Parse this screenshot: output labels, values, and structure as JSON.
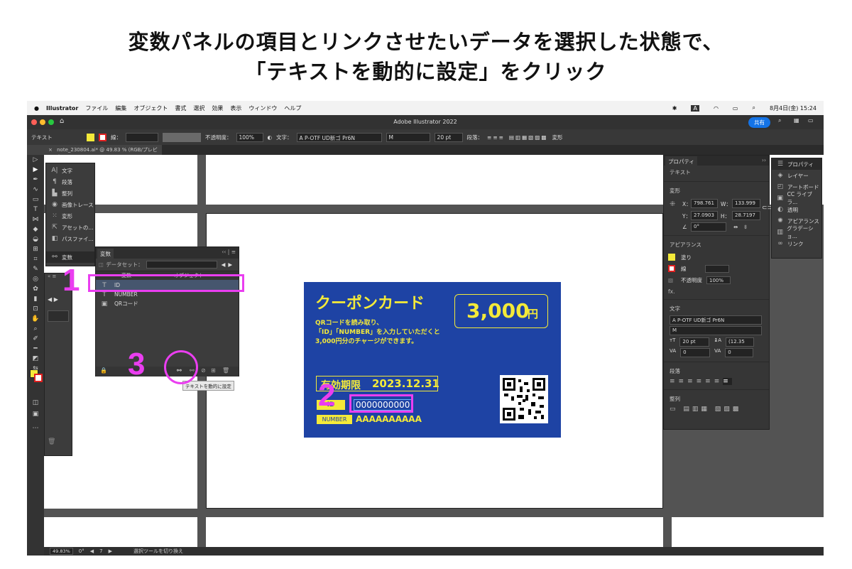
{
  "heading": {
    "line1": "変数パネルの項目とリンクさせたいデータを選択した状態で、",
    "line2": "「テキストを動的に設定」をクリック"
  },
  "menubar": {
    "app": "Illustrator",
    "items": [
      "ファイル",
      "編集",
      "オブジェクト",
      "書式",
      "選択",
      "効果",
      "表示",
      "ウィンドウ",
      "ヘルプ"
    ],
    "ime": "A",
    "date": "8月4日(金)  15:24"
  },
  "window": {
    "title": "Adobe Illustrator 2022",
    "share": "共有"
  },
  "control": {
    "mode": "テキスト",
    "stroke_label": "線：",
    "opacity_label": "不透明度：",
    "opacity": "100%",
    "font_label": "文字：",
    "font": "A P-OTF UD新ゴ Pr6N",
    "weight": "M",
    "size": "20 pt",
    "para_label": "段落：",
    "transform": "変形"
  },
  "doc_tab": {
    "close": "×",
    "label": "note_230804.ai* @ 49.83 % (RGB/プレビュー)"
  },
  "collapsed_panels": [
    "文字",
    "段落",
    "整列",
    "画像トレース",
    "変形",
    "アセットの...",
    "パスファイ...",
    "変数"
  ],
  "variables_panel": {
    "tab": "変数",
    "dataset_label": "データセット：",
    "col_var": "変数",
    "col_obj": "オブジェクト",
    "rows": [
      {
        "type": "T",
        "name": "ID"
      },
      {
        "type": "T",
        "name": "NUMBER"
      },
      {
        "type": "▣",
        "name": "QRコード"
      }
    ],
    "tooltip": "テキストを動的に設定"
  },
  "coupon": {
    "title": "クーポンカード",
    "amount": "3,000",
    "yen": "円",
    "desc1": "QRコードを読み取り、",
    "desc2": "「ID」「NUMBER」を入力していただくと",
    "desc3": "3,000円分のチャージができます。",
    "expiry_label": "有効期限",
    "expiry_date": "2023.12.31",
    "id_label": "ID",
    "id_value": "0000000000",
    "number_label": "NUMBER",
    "number_value": "AAAAAAAAAA"
  },
  "markers": [
    "1",
    "2",
    "3"
  ],
  "properties": {
    "tab": "プロパティ",
    "kind": "テキスト",
    "transform": "変形",
    "x_label": "X：",
    "x": "798.761",
    "w_label": "W：",
    "w": "133.999",
    "y_label": "Y：",
    "y": "27.0903",
    "h_label": "H：",
    "h": "28.7197",
    "angle": "0°",
    "appearance": "アピアランス",
    "fill": "塗り",
    "stroke": "線",
    "opacity_label": "不透明度",
    "opacity": "100%",
    "fx": "fx.",
    "char_section": "文字",
    "font": "A P-OTF UD新ゴ Pr6N",
    "weight": "M",
    "size": "20 pt",
    "leading": "(12.35",
    "tracking": "0",
    "kerning": "0",
    "para_section": "段落",
    "align_section": "整列"
  },
  "side_panels": [
    "プロパティ",
    "レイヤー",
    "アートボード",
    "CC ライブラ...",
    "透明",
    "アピアランス",
    "グラデーショ...",
    "リンク"
  ],
  "status": {
    "zoom": "49.83%",
    "rotate": "0°",
    "artboard": "7",
    "tool": "選択ツールを切り換え"
  }
}
